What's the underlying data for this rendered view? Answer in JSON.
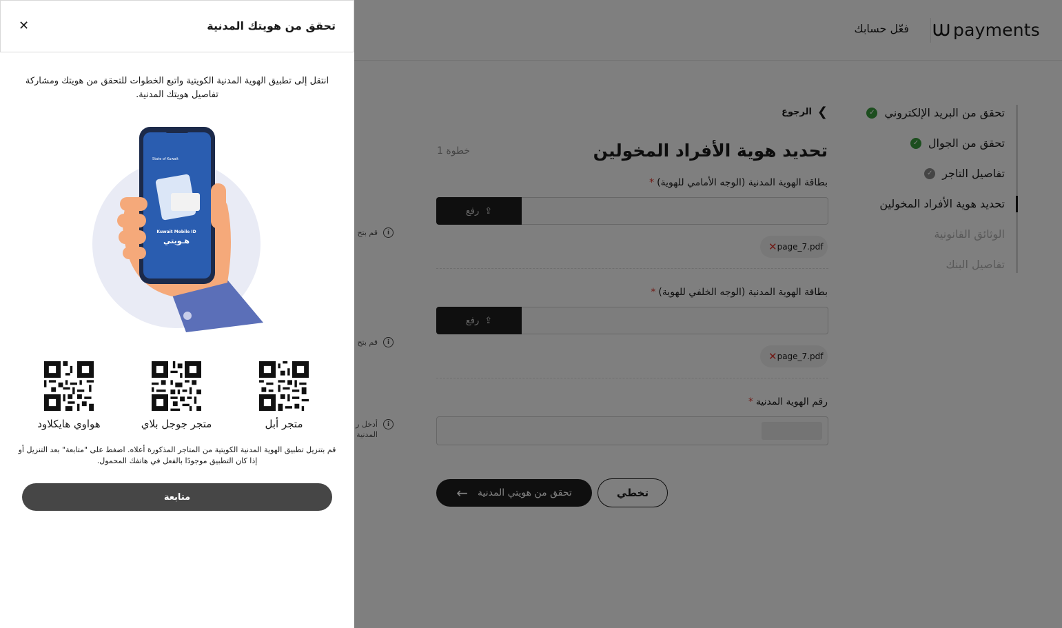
{
  "header": {
    "logo_text": "payments",
    "activate_account": "فعّل حسابك"
  },
  "steps": [
    {
      "label": "تحقق من البريد الإلكتروني",
      "state": "done"
    },
    {
      "label": "تحقق من الجوال",
      "state": "done"
    },
    {
      "label": "تفاصيل التاجر",
      "state": "pending"
    },
    {
      "label": "تحديد هوية الأفراد المخولين",
      "state": "current"
    },
    {
      "label": "الوثائق القانونية",
      "state": "todo"
    },
    {
      "label": "تفاصيل البنك",
      "state": "todo"
    }
  ],
  "form": {
    "back_label": "الرجوع",
    "title": "تحديد هوية الأفراد المخولين",
    "step_label": "خطوة 1",
    "front_id_label": "بطاقة الهوية المدنية (الوجه الأمامي للهوية)",
    "back_id_label": "بطاقة الهوية المدنية (الوجه الخلفي للهوية)",
    "civil_id_label": "رقم الهوية المدنية",
    "required_mark": "*",
    "upload_label": "رفع",
    "front_file": "page_7.pdf",
    "back_file": "page_7.pdf",
    "hint_upload_1": "قم بتح",
    "hint_upload_2": "قم بتح",
    "hint_civil_1": "أدخل ر",
    "hint_civil_2": "المدنية",
    "verify_button": "تحقق من هويتي المدنية",
    "skip_button": "تخطي"
  },
  "drawer": {
    "title": "تحقق من هويتك المدنية",
    "instructions": "انتقل إلى تطبيق الهوية المدنية الكويتية واتبع الخطوات للتحقق من هويتك ومشاركة تفاصيل هويتك المدنية.",
    "phone_app_name": "Kuwait Mobile ID",
    "phone_app_arabic": "هـويتي",
    "phone_state": "State of Kuwait",
    "stores": [
      {
        "label": "متجر أبل"
      },
      {
        "label": "متجر جوجل بلاي"
      },
      {
        "label": "هواوي هايكلاود"
      }
    ],
    "download_note": "قم بتنزيل تطبيق الهوية المدنية الكويتية من المتاجر المذكورة أعلاه. اضغط على \"متابعة\" بعد التنزيل أو إذا كان التطبيق موجودًا بالفعل في هاتفك المحمول.",
    "continue_button": "متابعة"
  },
  "colors": {
    "success": "#3a9d3e",
    "pending": "#8a8a8a",
    "dark": "#1f1f1f",
    "error": "#e0362c"
  }
}
